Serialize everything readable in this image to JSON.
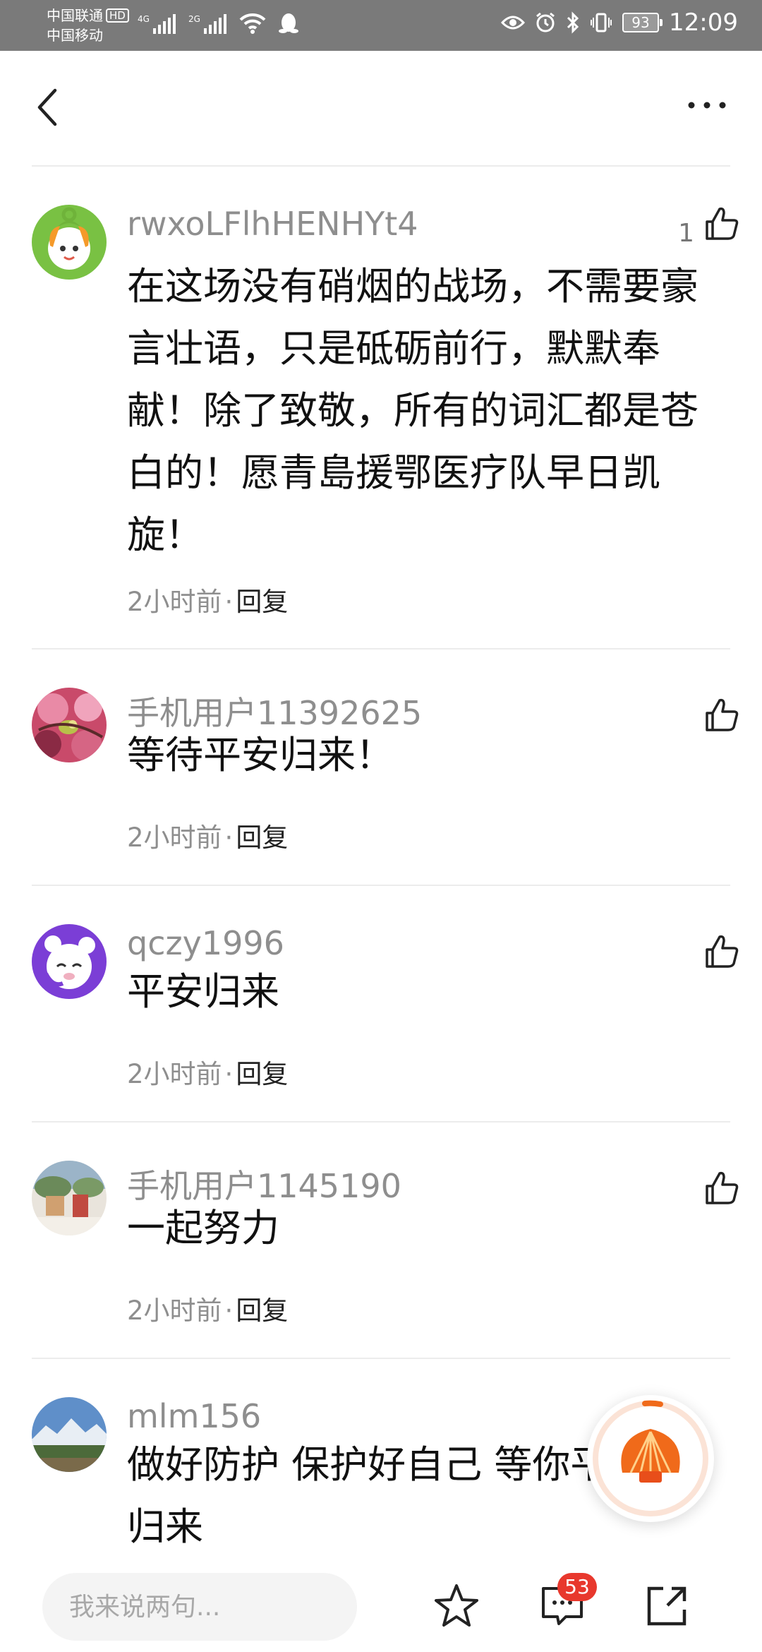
{
  "status_bar": {
    "carrier_1": "中国联通",
    "hd_badge": "HD",
    "carrier_2": "中国移动",
    "sig_1": "4G",
    "sig_2": "2G",
    "battery": "93",
    "time": "12:09"
  },
  "comments": [
    {
      "username": "rwxoLFlhHENHYt4",
      "text": "在这场没有硝烟的战场，不需要豪言壮语，只是砥砺前行，默默奉献！除了致敬，所有的词汇都是苍白的！愿青島援鄂医疗队早日凯旋！",
      "time": "2小时前",
      "separator": "·",
      "reply": "回复",
      "likes": "1"
    },
    {
      "username": "手机用户11392625",
      "text": "等待平安归来！",
      "time": "2小时前",
      "separator": "·",
      "reply": "回复",
      "likes": ""
    },
    {
      "username": "qczy1996",
      "text": "平安归来",
      "time": "2小时前",
      "separator": "·",
      "reply": "回复",
      "likes": ""
    },
    {
      "username": "手机用户1145190",
      "text": "一起努力",
      "time": "2小时前",
      "separator": "·",
      "reply": "回复",
      "likes": ""
    },
    {
      "username": "mlm156",
      "text": "做好防护 保护好自己 等你平安归来",
      "time": "",
      "separator": "",
      "reply": "",
      "likes": ""
    }
  ],
  "bottom_bar": {
    "input_placeholder": "我来说两句...",
    "comment_count": "53"
  },
  "colors": {
    "status_bar_bg": "#7a7a7a",
    "badge_red": "#e8382d",
    "fab_orange": "#f06a1a"
  },
  "icons": [
    "back-arrow-icon",
    "more-dots-icon",
    "thumbs-up-icon",
    "star-icon",
    "comment-icon",
    "share-icon"
  ]
}
